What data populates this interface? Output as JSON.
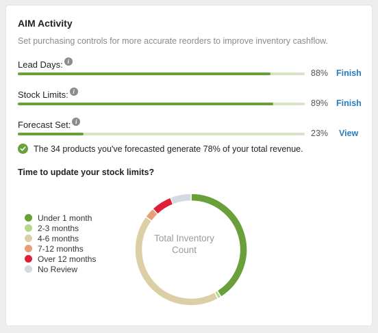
{
  "card": {
    "title": "AIM Activity",
    "subtitle": "Set purchasing controls for more accurate reorders to improve inventory cashflow."
  },
  "metrics": [
    {
      "label": "Lead Days:",
      "percent_text": "88%",
      "progress": 0.88,
      "action": "Finish"
    },
    {
      "label": "Stock Limits:",
      "percent_text": "89%",
      "progress": 0.89,
      "action": "Finish"
    },
    {
      "label": "Forecast Set:",
      "percent_text": "23%",
      "progress": 0.23,
      "action": "View"
    }
  ],
  "note": {
    "text": "The 34 products you've forecasted generate 78% of your total revenue."
  },
  "section": {
    "title": "Time to update your stock limits?"
  },
  "chart_data": {
    "type": "pie",
    "categories": [
      "Under 1 month",
      "2-3 months",
      "4-6 months",
      "7-12 months",
      "Over 12 months",
      "No Review"
    ],
    "values": [
      41,
      1,
      43,
      3,
      6,
      6
    ],
    "colors": [
      "#6aa03a",
      "#b5d98a",
      "#dccfa6",
      "#e89f78",
      "#df1f3a",
      "#d4d9e2"
    ],
    "center_label_line1": "Total Inventory",
    "center_label_line2": "Count",
    "legend_position": "left"
  },
  "colors": {
    "accent_green": "#6aa03a",
    "track": "#d6e3c4",
    "link_blue": "#2a7dbf"
  }
}
